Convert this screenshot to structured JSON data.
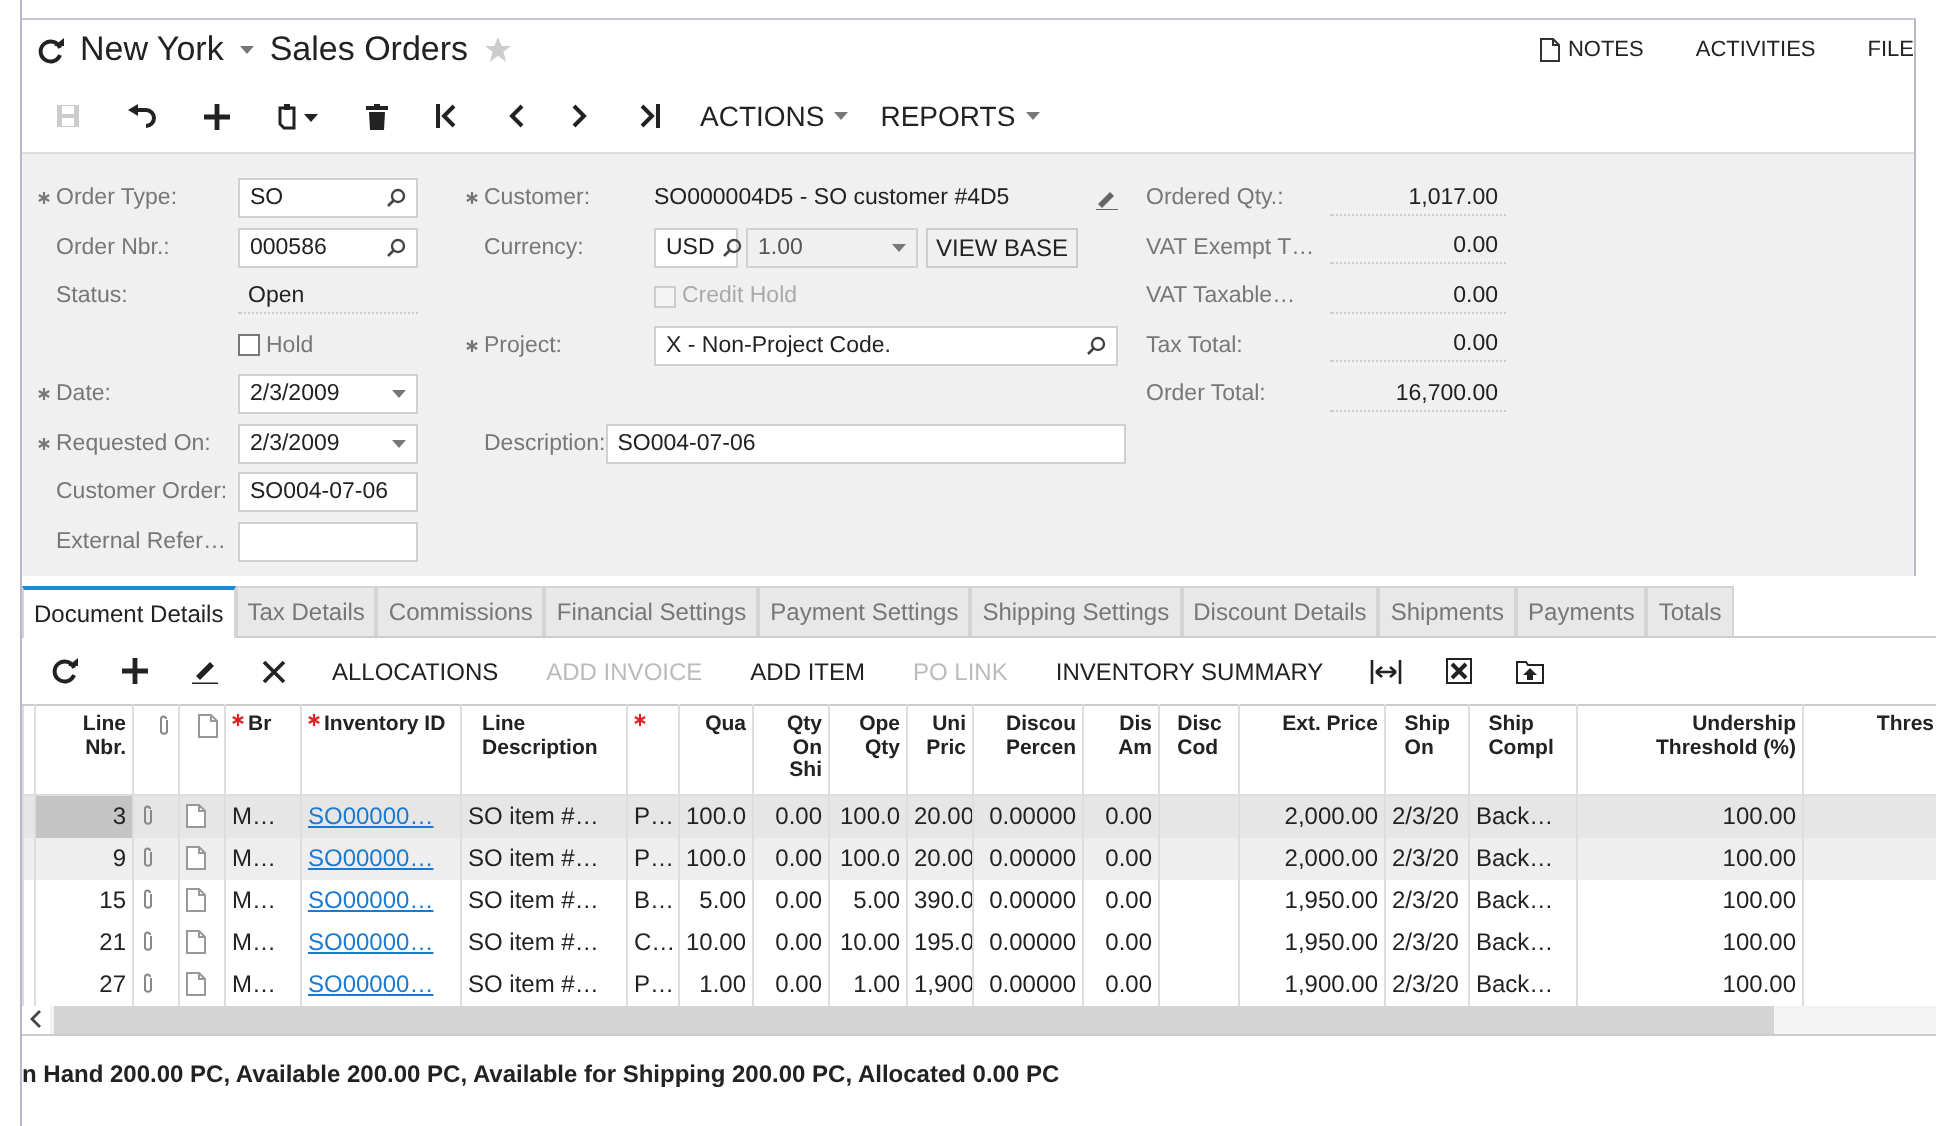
{
  "header": {
    "location": "New York",
    "title": "Sales Orders",
    "favorite": false,
    "links": [
      {
        "label": "NOTES",
        "has_icon": true
      },
      {
        "label": "ACTIVITIES",
        "has_icon": false
      },
      {
        "label": "FILE",
        "has_icon": false
      }
    ]
  },
  "toolbar": {
    "icon_buttons": [
      {
        "disabled": true
      },
      {
        "disabled": false
      },
      {
        "disabled": false
      },
      {
        "disabled": false
      },
      {
        "disabled": false
      },
      {
        "disabled": false
      },
      {
        "disabled": false
      },
      {
        "disabled": false
      },
      {
        "disabled": false
      }
    ],
    "menus": [
      {
        "label": "ACTIONS"
      },
      {
        "label": "REPORTS"
      }
    ]
  },
  "form": {
    "left": [
      {
        "kind": "lookup",
        "label": "Order Type:",
        "required": true,
        "value": "SO"
      },
      {
        "kind": "lookup",
        "label": "Order Nbr.:",
        "required": false,
        "value": "000586"
      },
      {
        "kind": "readonly",
        "label": "Status:",
        "required": false,
        "value": "Open"
      },
      {
        "kind": "checkbox",
        "label": "Hold",
        "checked": false,
        "disabled": false
      },
      {
        "kind": "date",
        "label": "Date:",
        "required": true,
        "value": "2/3/2009"
      },
      {
        "kind": "date",
        "label": "Requested On:",
        "required": true,
        "value": "2/3/2009"
      },
      {
        "kind": "text",
        "label": "Customer Order:",
        "required": false,
        "value": "SO004-07-06"
      },
      {
        "kind": "text",
        "label": "External Refer…",
        "required": false
      }
    ],
    "middle": [
      {
        "kind": "customer",
        "label": "Customer:",
        "required": true,
        "value": "SO000004D5 - SO customer #4D5"
      },
      {
        "kind": "currency",
        "label": "Currency:",
        "required": false,
        "value": "USD",
        "rate": "1.00",
        "button": "VIEW BASE"
      },
      {
        "kind": "checkbox",
        "label": "Credit Hold",
        "checked": false,
        "disabled": true
      },
      {
        "kind": "lookup",
        "label": "Project:",
        "required": true,
        "value": "X - Non-Project Code."
      },
      {
        "kind": "text",
        "label": "Description:",
        "required": false,
        "value": "SO004-07-06"
      }
    ],
    "totals": [
      {
        "label": "Ordered Qty.:",
        "value": "1,017.00"
      },
      {
        "label": "VAT Exempt T…",
        "value": "0.00"
      },
      {
        "label": "VAT Taxable…",
        "value": "0.00"
      },
      {
        "label": "Tax Total:",
        "value": "0.00"
      },
      {
        "label": "Order Total:",
        "value": "16,700.00"
      }
    ]
  },
  "tabs": [
    {
      "label": "Document Details",
      "selected": true
    },
    {
      "label": "Tax Details",
      "selected": false
    },
    {
      "label": "Commissions",
      "selected": false
    },
    {
      "label": "Financial Settings",
      "selected": false
    },
    {
      "label": "Payment Settings",
      "selected": false
    },
    {
      "label": "Shipping Settings",
      "selected": false
    },
    {
      "label": "Discount Details",
      "selected": false
    },
    {
      "label": "Shipments",
      "selected": false
    },
    {
      "label": "Payments",
      "selected": false
    },
    {
      "label": "Totals",
      "selected": false
    }
  ],
  "grid_toolbar": {
    "icon_buttons": [
      {
        "disabled": false
      },
      {
        "disabled": false
      },
      {
        "disabled": false
      },
      {
        "disabled": false
      }
    ],
    "actions": [
      {
        "label": "ALLOCATIONS",
        "disabled": false
      },
      {
        "label": "ADD INVOICE",
        "disabled": true
      },
      {
        "label": "ADD ITEM",
        "disabled": false
      },
      {
        "label": "PO LINK",
        "disabled": true
      },
      {
        "label": "INVENTORY SUMMARY",
        "disabled": false
      }
    ],
    "tool_icons": [
      {
        "disabled": false
      },
      {
        "disabled": false
      },
      {
        "disabled": false
      }
    ]
  },
  "table": {
    "columns": [
      {
        "kind": "num",
        "label": "Line Nbr.",
        "required": false
      },
      {
        "kind": "attach",
        "required": false
      },
      {
        "kind": "note",
        "required": false
      },
      {
        "kind": "text",
        "label": "Br",
        "required": true
      },
      {
        "kind": "link",
        "label": "Inventory ID",
        "required": true
      },
      {
        "kind": "text",
        "label": "Line Description",
        "required": false
      },
      {
        "kind": "text",
        "required": true
      },
      {
        "kind": "num",
        "label": "Qua",
        "required": false
      },
      {
        "kind": "num",
        "label": "Qty On Shi",
        "required": false
      },
      {
        "kind": "num",
        "label": "Ope Qty",
        "required": false
      },
      {
        "kind": "num",
        "label": "Uni Pric",
        "required": false
      },
      {
        "kind": "num",
        "label": "Discou Percen",
        "required": false
      },
      {
        "kind": "num",
        "label": "Dis Am",
        "required": false
      },
      {
        "kind": "text",
        "label": "Disc Cod",
        "required": false
      },
      {
        "kind": "num",
        "label": "Ext. Price",
        "required": false
      },
      {
        "kind": "text",
        "label": "Ship On",
        "required": false
      },
      {
        "kind": "text",
        "label": "Ship Compl",
        "required": false
      },
      {
        "kind": "num",
        "label": "Undership Threshold (%)",
        "required": false
      },
      {
        "kind": "num",
        "label": "Thres",
        "required": false
      }
    ],
    "rows": [
      {
        "selected": true,
        "highlighted": false,
        "cells": [
          "3",
          null,
          null,
          "M…",
          "SO00000…",
          "SO item #…",
          "P…",
          "100.0",
          "0.00",
          "100.0",
          "20.00",
          "0.00000",
          "0.00",
          null,
          "2,000.00",
          "2/3/20",
          "Back…",
          "100.00",
          null
        ]
      },
      {
        "selected": false,
        "highlighted": true,
        "cells": [
          "9",
          null,
          null,
          "M…",
          "SO00000…",
          "SO item #…",
          "P…",
          "100.0",
          "0.00",
          "100.0",
          "20.00",
          "0.00000",
          "0.00",
          null,
          "2,000.00",
          "2/3/20",
          "Back…",
          "100.00",
          null
        ]
      },
      {
        "selected": false,
        "highlighted": false,
        "cells": [
          "15",
          null,
          null,
          "M…",
          "SO00000…",
          "SO item #…",
          "B…",
          "5.00",
          "0.00",
          "5.00",
          "390.0",
          "0.00000",
          "0.00",
          null,
          "1,950.00",
          "2/3/20",
          "Back…",
          "100.00",
          null
        ]
      },
      {
        "selected": false,
        "highlighted": false,
        "cells": [
          "21",
          null,
          null,
          "M…",
          "SO00000…",
          "SO item #…",
          "C…",
          "10.00",
          "0.00",
          "10.00",
          "195.0",
          "0.00000",
          "0.00",
          null,
          "1,950.00",
          "2/3/20",
          "Back…",
          "100.00",
          null
        ]
      },
      {
        "selected": false,
        "highlighted": false,
        "cells": [
          "27",
          null,
          null,
          "M…",
          "SO00000…",
          "SO item #…",
          "P…",
          "1.00",
          "0.00",
          "1.00",
          "1,900",
          "0.00000",
          "0.00",
          null,
          "1,900.00",
          "2/3/20",
          "Back…",
          "100.00",
          null
        ]
      }
    ]
  },
  "status_bar": "n Hand 200.00 PC, Available 200.00 PC, Available for Shipping 200.00 PC, Allocated 0.00 PC"
}
